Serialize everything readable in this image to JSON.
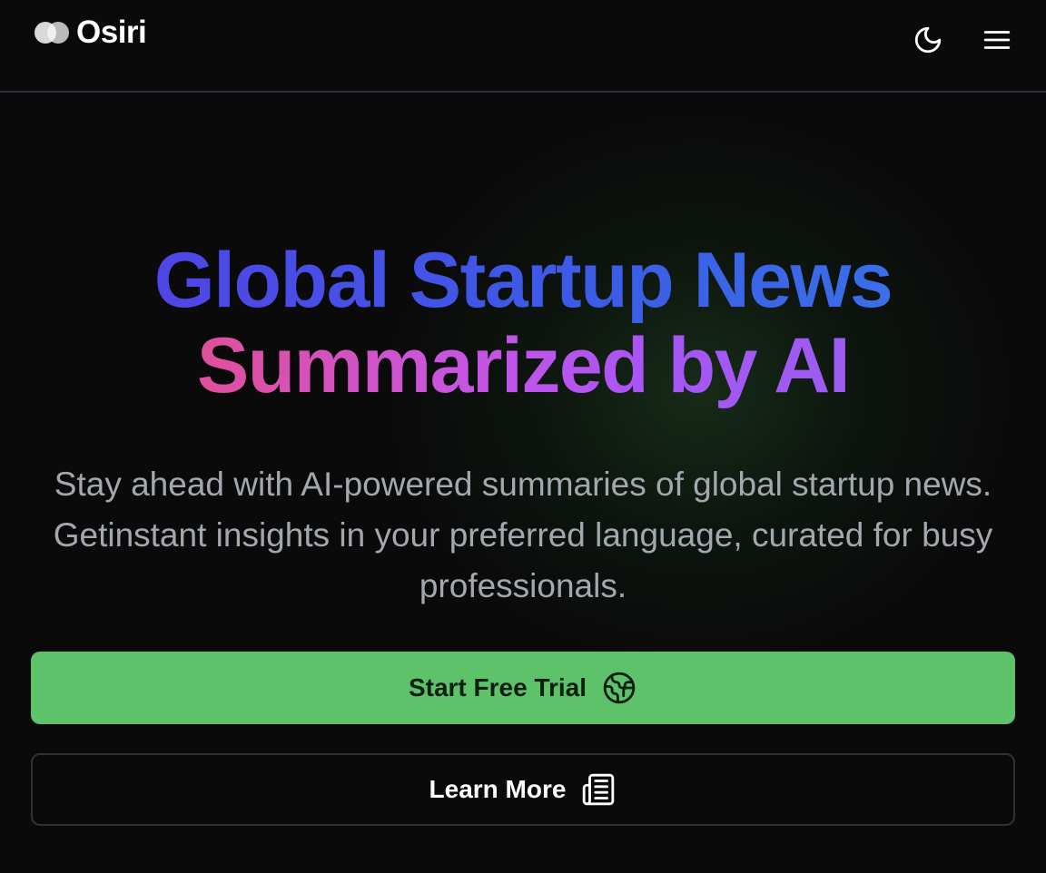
{
  "header": {
    "brand": "Osiri",
    "theme_toggle_icon": "moon-icon",
    "menu_icon": "hamburger-menu-icon"
  },
  "hero": {
    "title_line1": "Global Startup News",
    "title_line2": "Summarized by AI",
    "subtitle": "Stay ahead with AI-powered summaries of global startup news. Getinstant insights in your preferred language, curated for busy professionals."
  },
  "cta": {
    "primary_label": "Start Free Trial",
    "primary_icon": "globe-icon",
    "secondary_label": "Learn More",
    "secondary_icon": "newspaper-icon"
  },
  "colors": {
    "background": "#0a0a0a",
    "primary_button": "#5ec26a",
    "title_gradient_start": "#4f46e5",
    "title_gradient_end": "#3b6ee8",
    "title2_gradient_start": "#e0509a",
    "title2_gradient_end": "#9b5cf0",
    "subtitle_text": "#a3a7ae"
  }
}
